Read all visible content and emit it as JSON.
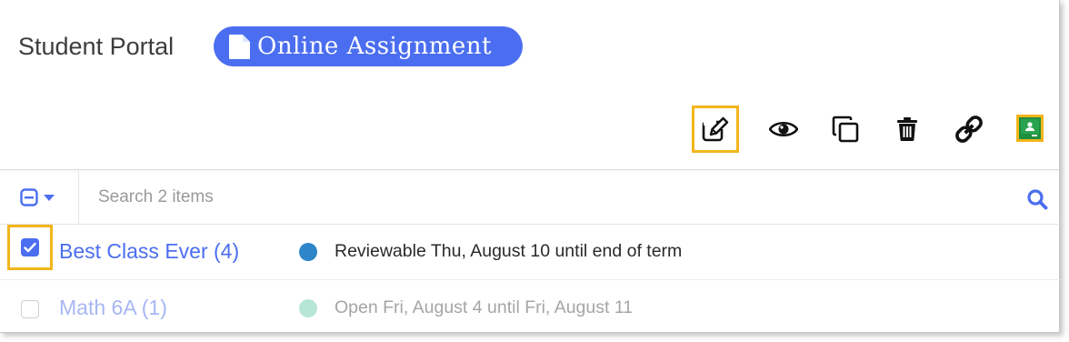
{
  "header": {
    "portal_title": "Student Portal",
    "assignment_label": "Online Assignment",
    "accent_color": "#4b6ef0"
  },
  "toolbar": {
    "buttons": [
      {
        "name": "edit",
        "icon": "edit-icon",
        "highlighted": true
      },
      {
        "name": "preview",
        "icon": "eye-icon",
        "highlighted": false
      },
      {
        "name": "duplicate",
        "icon": "copy-icon",
        "highlighted": false
      },
      {
        "name": "delete",
        "icon": "trash-icon",
        "highlighted": false
      },
      {
        "name": "link",
        "icon": "link-icon",
        "highlighted": false
      },
      {
        "name": "google-classroom",
        "icon": "google-classroom-icon",
        "highlighted": true
      }
    ],
    "highlight_color": "#f2b51c"
  },
  "search": {
    "placeholder": "Search 2 items"
  },
  "classes": [
    {
      "name": "Best Class Ever (4)",
      "checked": true,
      "status": "Reviewable Thu, August 10 until end of term",
      "status_color": "#2e86c9"
    },
    {
      "name": "Math 6A (1)",
      "checked": false,
      "status": "Open Fri, August 4 until Fri, August 11",
      "status_color": "#b7e6d6"
    }
  ]
}
